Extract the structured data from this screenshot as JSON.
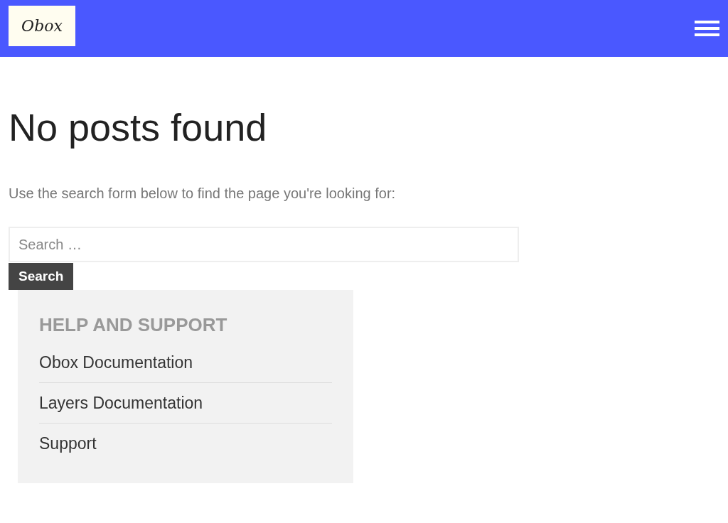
{
  "header": {
    "logo": "Obox"
  },
  "page": {
    "title": "No posts found",
    "message": "Use the search form below to find the page you're looking for:"
  },
  "search": {
    "placeholder": "Search …",
    "button": "Search"
  },
  "widget": {
    "title": "HELP AND SUPPORT",
    "links": [
      {
        "label": "Obox Documentation"
      },
      {
        "label": "Layers Documentation"
      },
      {
        "label": "Support"
      }
    ]
  }
}
